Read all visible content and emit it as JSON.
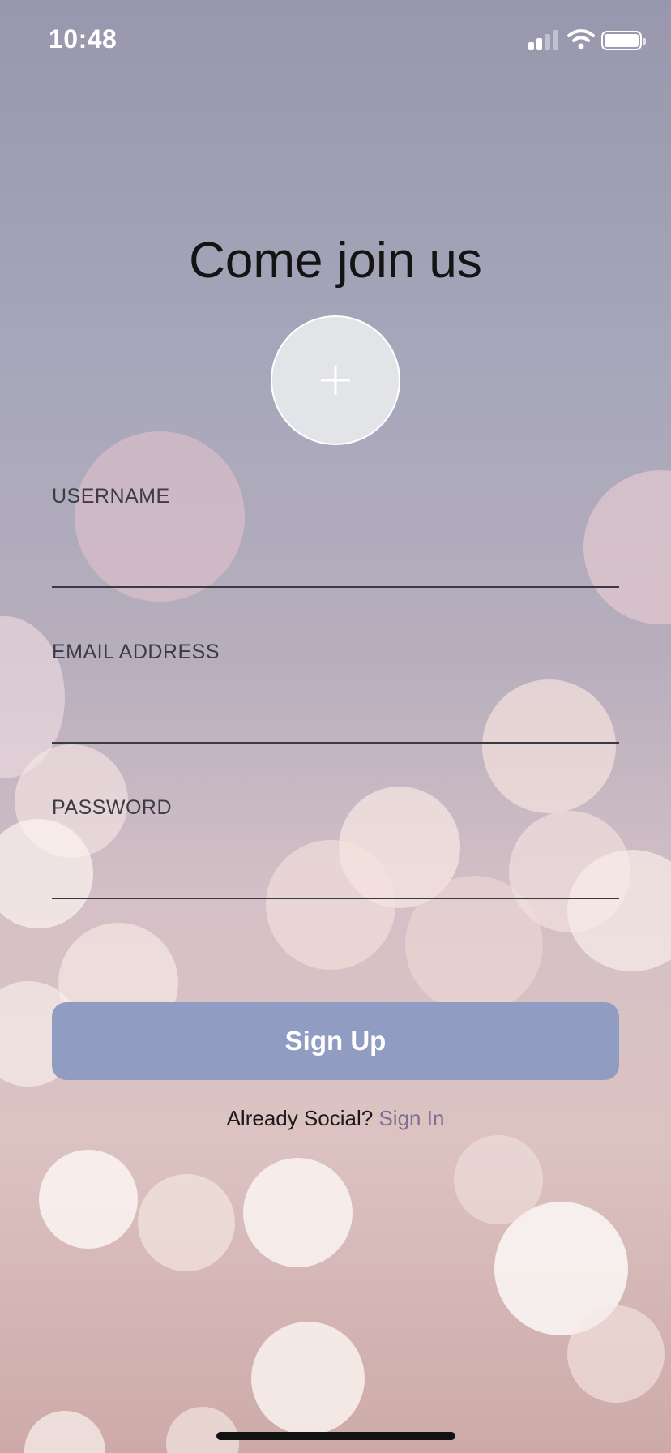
{
  "status_bar": {
    "time": "10:48",
    "icons": [
      "cellular-signal-icon",
      "wifi-icon",
      "battery-icon"
    ]
  },
  "screen": {
    "title": "Come join us",
    "avatar_button_icon": "plus-icon"
  },
  "form": {
    "username": {
      "label": "USERNAME",
      "value": "",
      "placeholder": ""
    },
    "email": {
      "label": "EMAIL ADDRESS",
      "value": "",
      "placeholder": ""
    },
    "password": {
      "label": "PASSWORD",
      "value": "",
      "placeholder": ""
    }
  },
  "actions": {
    "signup_label": "Sign Up",
    "signin_prompt": "Already Social?",
    "signin_link": "Sign In"
  },
  "colors": {
    "button_bg": "#919cc2",
    "link": "#7d6f95",
    "title": "#141414"
  }
}
